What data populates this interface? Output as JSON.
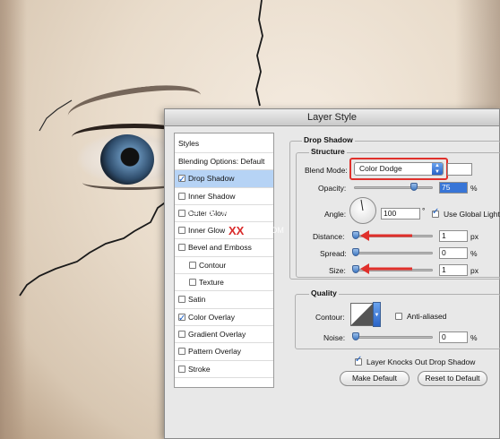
{
  "dialog": {
    "title": "Layer Style"
  },
  "styles_list": {
    "header": "Styles",
    "items": [
      {
        "label": "Blending Options: Default",
        "checkbox": false,
        "checked": false,
        "selected": false,
        "indent": false
      },
      {
        "label": "Drop Shadow",
        "checkbox": true,
        "checked": true,
        "selected": true,
        "indent": false
      },
      {
        "label": "Inner Shadow",
        "checkbox": true,
        "checked": false,
        "selected": false,
        "indent": false
      },
      {
        "label": "Outer Glow",
        "checkbox": true,
        "checked": false,
        "selected": false,
        "indent": false
      },
      {
        "label": "Inner Glow",
        "checkbox": true,
        "checked": false,
        "selected": false,
        "indent": false
      },
      {
        "label": "Bevel and Emboss",
        "checkbox": true,
        "checked": false,
        "selected": false,
        "indent": false
      },
      {
        "label": "Contour",
        "checkbox": true,
        "checked": false,
        "selected": false,
        "indent": true
      },
      {
        "label": "Texture",
        "checkbox": true,
        "checked": false,
        "selected": false,
        "indent": true
      },
      {
        "label": "Satin",
        "checkbox": true,
        "checked": false,
        "selected": false,
        "indent": false
      },
      {
        "label": "Color Overlay",
        "checkbox": true,
        "checked": true,
        "selected": false,
        "indent": false
      },
      {
        "label": "Gradient Overlay",
        "checkbox": true,
        "checked": false,
        "selected": false,
        "indent": false
      },
      {
        "label": "Pattern Overlay",
        "checkbox": true,
        "checked": false,
        "selected": false,
        "indent": false
      },
      {
        "label": "Stroke",
        "checkbox": true,
        "checked": false,
        "selected": false,
        "indent": false
      }
    ]
  },
  "drop_shadow": {
    "section_title": "Drop Shadow",
    "structure_title": "Structure",
    "blend_mode": {
      "label": "Blend Mode:",
      "value": "Color Dodge"
    },
    "opacity": {
      "label": "Opacity:",
      "value": "75",
      "unit": "%",
      "level": 0.75
    },
    "angle": {
      "label": "Angle:",
      "value": "100",
      "unit": "°",
      "use_global_light_label": "Use Global Light",
      "use_global_light": true
    },
    "distance": {
      "label": "Distance:",
      "value": "1",
      "unit": "px"
    },
    "spread": {
      "label": "Spread:",
      "value": "0",
      "unit": "%"
    },
    "size": {
      "label": "Size:",
      "value": "1",
      "unit": "px"
    }
  },
  "quality": {
    "title": "Quality",
    "contour_label": "Contour:",
    "anti_aliased_label": "Anti-aliased",
    "anti_aliased": false,
    "noise": {
      "label": "Noise:",
      "value": "0",
      "unit": "%"
    }
  },
  "footer": {
    "knockout_label": "Layer Knocks Out Drop Shadow",
    "knockout": true,
    "make_default": "Make Default",
    "reset_to_default": "Reset to Default"
  },
  "watermark": {
    "text1": "中 教 程 论 坛",
    "text2": "XX",
    "text3": "TT .COM"
  },
  "colors": {
    "highlight": "#e0302b",
    "selection": "#b6d3f5",
    "accent": "#3875d7"
  }
}
